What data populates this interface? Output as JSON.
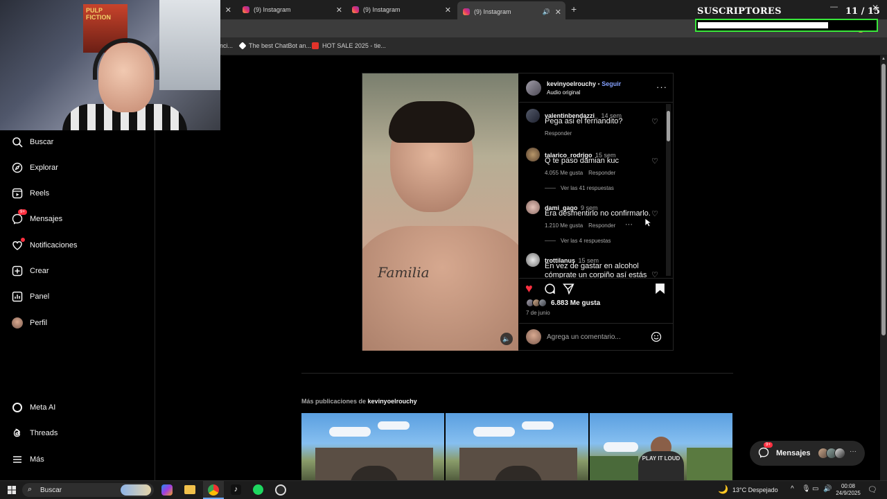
{
  "browser": {
    "tabs": [
      {
        "title": "(9) Instagram",
        "active": false
      },
      {
        "title": "(9) Instagram",
        "active": false
      },
      {
        "title": "(9) Instagram",
        "active": true
      }
    ],
    "new_tab": "+",
    "bookmarks": [
      {
        "label": "nci..."
      },
      {
        "label": "The best ChatBot an..."
      },
      {
        "label": "HOT SALE 2025 - tie..."
      }
    ]
  },
  "webcam": {
    "poster_text": "PULP FICTION"
  },
  "subscribers": {
    "title": "SUSCRIPTORES",
    "count": "11 / 15",
    "progress": 0.733,
    "bar_color": "#39e83a"
  },
  "sidebar": {
    "items": [
      {
        "label": "Buscar",
        "icon": "search-icon"
      },
      {
        "label": "Explorar",
        "icon": "compass-icon"
      },
      {
        "label": "Reels",
        "icon": "reels-icon"
      },
      {
        "label": "Mensajes",
        "icon": "messenger-icon",
        "badge": "9+"
      },
      {
        "label": "Notificaciones",
        "icon": "heart-icon"
      },
      {
        "label": "Crear",
        "icon": "plus-square-icon"
      },
      {
        "label": "Panel",
        "icon": "dashboard-icon"
      },
      {
        "label": "Perfil",
        "icon": "avatar"
      }
    ],
    "bottom_items": [
      {
        "label": "Meta AI",
        "icon": "meta-ai-icon"
      },
      {
        "label": "Threads",
        "icon": "threads-icon"
      },
      {
        "label": "Más",
        "icon": "menu-icon"
      }
    ]
  },
  "post": {
    "author": "kevinyoelrouchy",
    "separator": "•",
    "follow": "Seguir",
    "audio": "Audio original",
    "tattoo_text": "Familia",
    "comments": [
      {
        "user": "valentinbendazzi_",
        "time": "14 sem",
        "text": "Pega asi el fernandito?",
        "likes": "",
        "reply": "Responder",
        "view_replies": ""
      },
      {
        "user": "talarico_rodrigo",
        "time": "15 sem",
        "text": "Q te paso damian kuc",
        "likes": "4.055 Me gusta",
        "reply": "Responder",
        "view_replies": "Ver las 41 respuestas"
      },
      {
        "user": "dami_gago",
        "time": "9 sem",
        "text": "Era desmentirlo no confirmarlo.",
        "likes": "1.210 Me gusta",
        "reply": "Responder",
        "view_replies": "Ver las 4 respuestas"
      },
      {
        "user": "trottilanus",
        "time": "15 sem",
        "text": "En vez de gastar en alcohol cómprate un corpiño así estás",
        "likes": "",
        "reply": "",
        "view_replies": ""
      }
    ],
    "likes": "6.883 Me gusta",
    "date": "7 de junio",
    "comment_placeholder": "Agrega un comentario...",
    "like_color": "#ff3040"
  },
  "more": {
    "prefix": "Más publicaciones de",
    "author": "kevinyoelrouchy"
  },
  "thumbs": [
    {
      "shirt_text": ""
    },
    {
      "shirt_text": ""
    },
    {
      "shirt_text": "PLAY IT LOUD"
    }
  ],
  "messages_pill": {
    "label": "Mensajes",
    "badge": "9+"
  },
  "taskbar": {
    "search": "Buscar",
    "weather": "13°C  Despejado",
    "time": "00:08",
    "date": "24/9/2025"
  }
}
